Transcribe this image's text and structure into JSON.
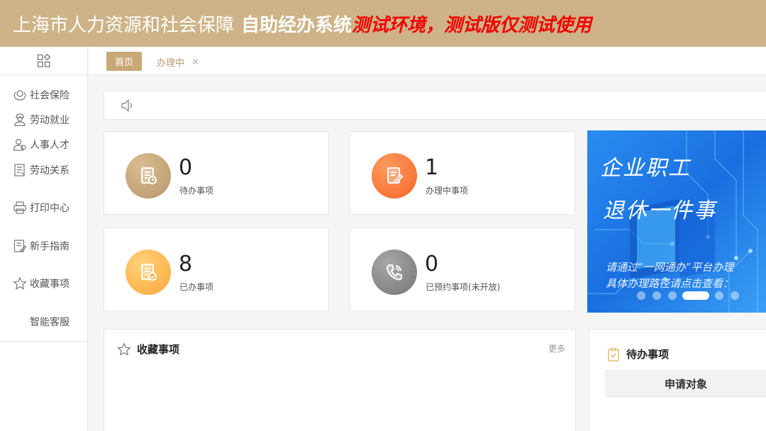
{
  "header": {
    "title": "上海市人力资源和社会保障",
    "system": "自助经办系统",
    "env_warning": "测试环境，测试版仅测试使用"
  },
  "sidebar": {
    "top_icon": "apps-grid-icon",
    "items": [
      {
        "label": "社会保险",
        "icon": "insurance-hands-icon"
      },
      {
        "label": "劳动就业",
        "icon": "worker-icon"
      },
      {
        "label": "人事人才",
        "icon": "people-icon"
      },
      {
        "label": "劳动关系",
        "icon": "document-list-icon"
      },
      {
        "label": "打印中心",
        "icon": "printer-icon"
      },
      {
        "label": "新手指南",
        "icon": "guide-edit-icon"
      },
      {
        "label": "收藏事项",
        "icon": "star-icon"
      },
      {
        "label": "智能客服",
        "icon": ""
      }
    ]
  },
  "tabs": {
    "home": "首页",
    "active": "办理中",
    "close": "×"
  },
  "notice": {
    "icon": "speaker-icon"
  },
  "stats": [
    {
      "value": "0",
      "label": "待办事项",
      "color": "#c9a878",
      "icon": "document-clock-icon"
    },
    {
      "value": "1",
      "label": "办理中事项",
      "color": "#ff7a3c",
      "icon": "document-pen-icon"
    },
    {
      "value": "8",
      "label": "已办事项",
      "color": "#fdb54a",
      "icon": "document-check-icon"
    },
    {
      "value": "0",
      "label": "已预约事项(未开放)",
      "color": "#8c8c8c",
      "icon": "phone-icon"
    }
  ],
  "banner": {
    "headline1": "企业职工",
    "headline2": "退休一件事",
    "line1": "请通过“一网通办”平台办理",
    "line2": "具体办理路径请点击查看："
  },
  "favorites": {
    "title": "收藏事项",
    "more": "更多"
  },
  "todo": {
    "title": "待办事项",
    "column": "申请对象"
  }
}
